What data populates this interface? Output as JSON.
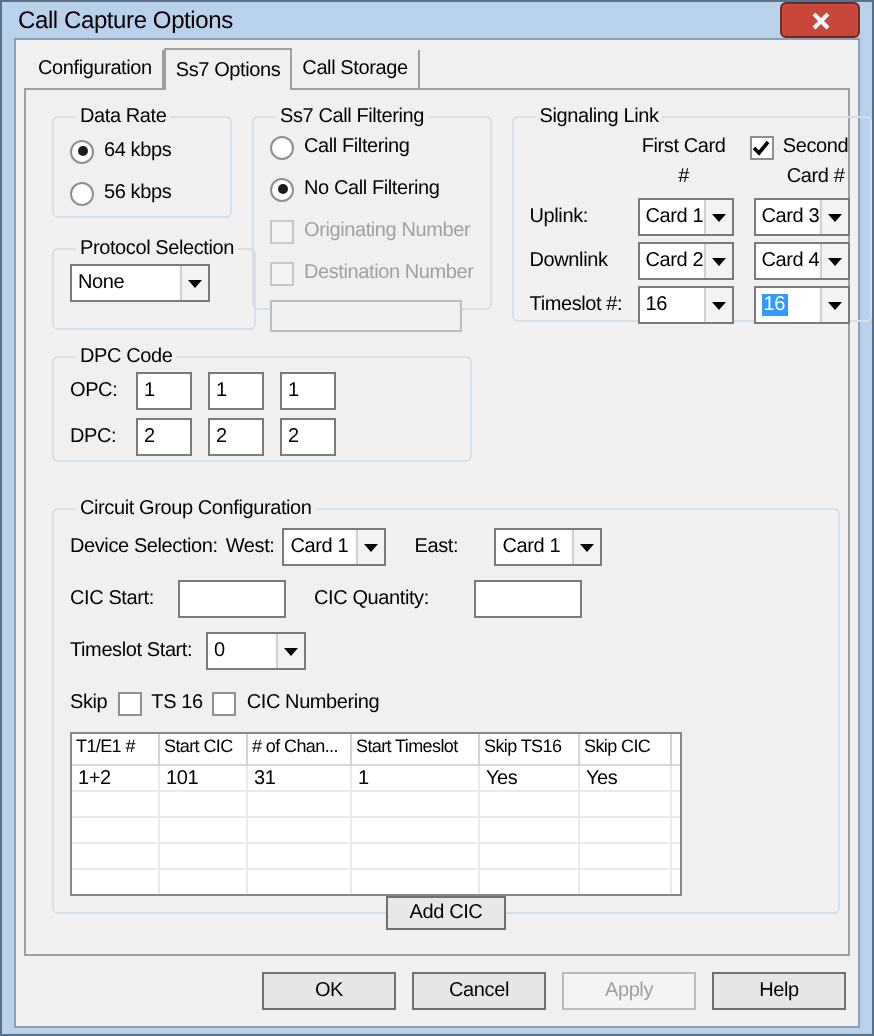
{
  "window": {
    "title": "Call Capture Options"
  },
  "tabs": [
    {
      "label": "Configuration",
      "selected": false
    },
    {
      "label": "Ss7 Options",
      "selected": true
    },
    {
      "label": "Call Storage",
      "selected": false
    }
  ],
  "data_rate": {
    "title": "Data Rate",
    "options": [
      {
        "label": "64 kbps",
        "selected": true
      },
      {
        "label": "56 kbps",
        "selected": false
      }
    ]
  },
  "protocol_selection": {
    "title": "Protocol Selection",
    "value": "None"
  },
  "call_filtering": {
    "title": "Ss7 Call Filtering",
    "options": [
      {
        "label": "Call Filtering",
        "selected": false
      },
      {
        "label": "No Call Filtering",
        "selected": true
      }
    ],
    "checkboxes": [
      {
        "label": "Originating Number",
        "checked": false,
        "disabled": true
      },
      {
        "label": "Destination Number",
        "checked": false,
        "disabled": true
      }
    ],
    "number_field": {
      "disabled": true
    }
  },
  "signaling_link": {
    "title": "Signaling Link",
    "first_header": "First Card #",
    "second": {
      "label": "Second Card #",
      "checked": true
    },
    "rows": [
      {
        "label": "Uplink:",
        "cells": [
          {
            "value": "Card 1",
            "highlighted": false
          },
          {
            "value": "Card 3",
            "highlighted": false
          }
        ]
      },
      {
        "label": "Downlink",
        "cells": [
          {
            "value": "Card 2",
            "highlighted": false
          },
          {
            "value": "Card 4",
            "highlighted": false
          }
        ]
      },
      {
        "label": "Timeslot #:",
        "cells": [
          {
            "value": "16",
            "highlighted": false
          },
          {
            "value": "16",
            "highlighted": true
          }
        ]
      }
    ]
  },
  "dpc_code": {
    "title": "DPC Code",
    "rows": [
      {
        "label": "OPC:",
        "values": [
          "1",
          "1",
          "1"
        ]
      },
      {
        "label": "DPC:",
        "values": [
          "2",
          "2",
          "2"
        ]
      }
    ]
  },
  "circuit_group": {
    "title": "Circuit Group Configuration",
    "device_selection_label": "Device Selection:",
    "west_label": "West:",
    "west_value": "Card 1",
    "east_label": "East:",
    "east_value": "Card 1",
    "cic_start_label": "CIC Start:",
    "cic_quantity_label": "CIC Quantity:",
    "timeslot_start_label": "Timeslot Start:",
    "timeslot_start_value": "0",
    "skip_label": "Skip",
    "skip_options": [
      {
        "label": "TS 16",
        "checked": false
      },
      {
        "label": "CIC Numbering",
        "checked": false
      }
    ],
    "table": {
      "columns": [
        "T1/E1 #",
        "Start CIC",
        "# of Chan...",
        "Start Timeslot",
        "Skip TS16",
        "Skip CIC"
      ],
      "rows": [
        [
          "1+2",
          "101",
          "31",
          "1",
          "Yes",
          "Yes"
        ]
      ]
    },
    "add_button": "Add CIC"
  },
  "buttons": [
    {
      "label": "OK",
      "disabled": false
    },
    {
      "label": "Cancel",
      "disabled": false
    },
    {
      "label": "Apply",
      "disabled": true
    },
    {
      "label": "Help",
      "disabled": false
    }
  ]
}
